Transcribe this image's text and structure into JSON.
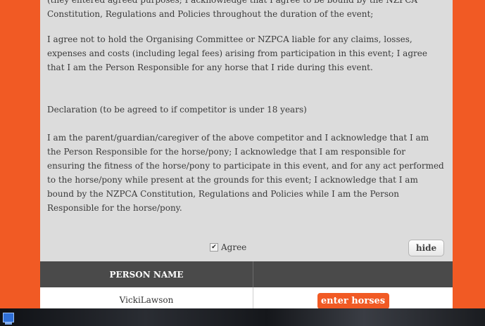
{
  "declaration": {
    "top_text": "(they entered agreed purposes; I acknowledge that I agree to be bound by the NZPCA Constitution, Regulations and Policies throughout the duration of the event;",
    "liability_text": "I agree not to hold the Organising Committee or NZPCA liable for any claims, losses, expenses and costs (including legal fees) arising from participation in this event; I agree that I am the Person Responsible for any horse that I ride during this event.",
    "guardian_heading": "Declaration (to be agreed to if competitor is under 18 years)",
    "guardian_text": "I am the parent/guardian/caregiver of the above competitor and I acknowledge that I am the Person Responsible for the horse/pony; I acknowledge that I am responsible for ensuring the fitness of the horse/pony to participate in this event, and for any act performed to the horse/pony while present at the grounds for this event; I acknowledge that I am bound by the NZPCA Constitution, Regulations and Policies while I am the Person Responsible for the horse/pony.",
    "agree_label": "Agree",
    "agree_checked": true,
    "hide_label": "hide"
  },
  "table": {
    "header_name": "PERSON NAME",
    "header_action": "",
    "rows": [
      {
        "name": "VickiLawson",
        "action_label": "enter horses"
      }
    ]
  },
  "colors": {
    "background": "#f15a24",
    "panel": "#dcdcdc",
    "table_header": "#4a4a4a",
    "button_accent": "#f15a24"
  }
}
